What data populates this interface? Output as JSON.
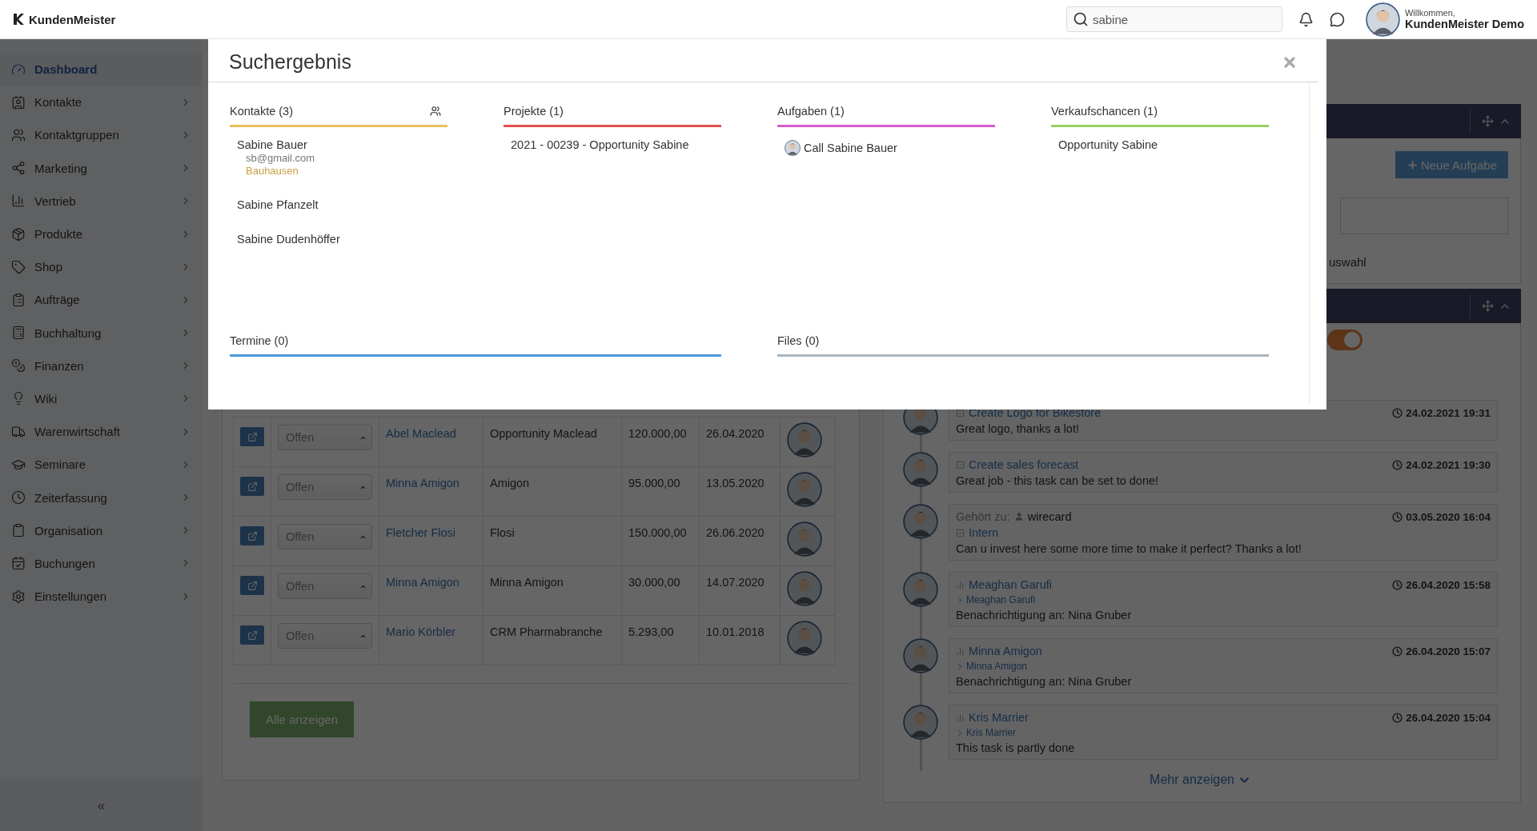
{
  "topbar": {
    "logo": "KundenMeister",
    "search": {
      "value": "sabine"
    },
    "welcome": "Willkommen,",
    "user": "KundenMeister Demo"
  },
  "sidebar": {
    "items": [
      {
        "label": "Dashboard",
        "selected": true
      },
      {
        "label": "Kontakte",
        "selected": false
      },
      {
        "label": "Kontaktgruppen",
        "selected": false
      },
      {
        "label": "Marketing",
        "selected": false
      },
      {
        "label": "Vertrieb",
        "selected": false
      },
      {
        "label": "Produkte",
        "selected": false
      },
      {
        "label": "Shop",
        "selected": false
      },
      {
        "label": "Aufträge",
        "selected": false
      },
      {
        "label": "Buchhaltung",
        "selected": false
      },
      {
        "label": "Finanzen",
        "selected": false
      },
      {
        "label": "Wiki",
        "selected": false
      },
      {
        "label": "Warenwirtschaft",
        "selected": false
      },
      {
        "label": "Seminare",
        "selected": false
      },
      {
        "label": "Zeiterfassung",
        "selected": false
      },
      {
        "label": "Organisation",
        "selected": false
      },
      {
        "label": "Buchungen",
        "selected": false
      },
      {
        "label": "Einstellungen",
        "selected": false
      }
    ],
    "collapse": "«"
  },
  "table": {
    "rows": [
      {
        "status": "Offen",
        "contact": "Abel Maclead",
        "title": "Opportunity Maclead",
        "amount": "120.000,00",
        "date": "26.04.2020"
      },
      {
        "status": "Offen",
        "contact": "Minna Amigon",
        "title": "Amigon",
        "amount": "95.000,00",
        "date": "13.05.2020"
      },
      {
        "status": "Offen",
        "contact": "Fletcher Flosi",
        "title": "Flosi",
        "amount": "150.000,00",
        "date": "26.06.2020"
      },
      {
        "status": "Offen",
        "contact": "Minna Amigon",
        "title": "Minna Amigon",
        "amount": "30.000,00",
        "date": "14.07.2020"
      },
      {
        "status": "Offen",
        "contact": "Mario Körbler",
        "title": "CRM Pharmabranche",
        "amount": "5.293,00",
        "date": "10.01.2018"
      }
    ],
    "show_all": "Alle anzeigen"
  },
  "tasks_panel": {
    "new_task": "Neue Aufgabe",
    "partial_label": "uswahl"
  },
  "feed_panel": {
    "toggle": {
      "on": true
    },
    "items": [
      {
        "kind": "task",
        "link": "Create Logo for Bikestore",
        "time": "24.02.2021 19:31",
        "text": "Great logo, thanks a lot!"
      },
      {
        "kind": "task",
        "link": "Create sales forecast",
        "time": "24.02.2021 19:30",
        "text": "Great job - this task can be set to done!"
      },
      {
        "kind": "task",
        "belongs_label": "Gehört zu:",
        "belongs": "wirecard",
        "link": "Intern",
        "time": "03.05.2020 16:04",
        "text": "Can u invest here some more time to make it perfect? Thanks a lot!"
      },
      {
        "kind": "deal",
        "link": "Meaghan Garufi",
        "sub": "Meaghan Garufi",
        "time": "26.04.2020 15:58",
        "text": "Benachrichtigung an: Nina Gruber"
      },
      {
        "kind": "deal",
        "link": "Minna Amigon",
        "sub": "Minna Amigon",
        "time": "26.04.2020 15:07",
        "text": "Benachrichtigung an: Nina Gruber"
      },
      {
        "kind": "deal",
        "link": "Kris Marrier",
        "sub": "Kris Marrier",
        "time": "26.04.2020 15:04",
        "text": "This task is partly done"
      }
    ],
    "more": "Mehr anzeigen"
  },
  "modal": {
    "title": "Suchergebnis",
    "sections": [
      {
        "kind": "contacts",
        "title": "Kontakte (3)",
        "color": "#e8c15a",
        "items": [
          {
            "kind": "contact",
            "name": "Sabine Bauer",
            "email": "sb@gmail.com",
            "company": "Bauhausen"
          },
          {
            "kind": "entry",
            "name": "Sabine Pfanzelt"
          },
          {
            "kind": "entry",
            "name": "Sabine Dudenhöffer"
          }
        ]
      },
      {
        "kind": "projects",
        "title": "Projekte (1)",
        "color": "#e05050",
        "items": [
          {
            "kind": "entry",
            "name": "2021 - 00239 - Opportunity Sabine"
          }
        ]
      },
      {
        "kind": "tasks",
        "title": "Aufgaben (1)",
        "color": "#d65ccb",
        "items": [
          {
            "kind": "task",
            "name": "Call Sabine Bauer"
          }
        ]
      },
      {
        "kind": "opportunities",
        "title": "Verkaufschancen (1)",
        "color": "#9bcf62",
        "items": [
          {
            "kind": "entry",
            "name": "Opportunity Sabine"
          }
        ]
      }
    ],
    "wide_sections": [
      {
        "title": "Termine (0)",
        "color": "#4a98de"
      },
      {
        "title": "Files (0)",
        "color": "#a9b6c2"
      }
    ]
  }
}
